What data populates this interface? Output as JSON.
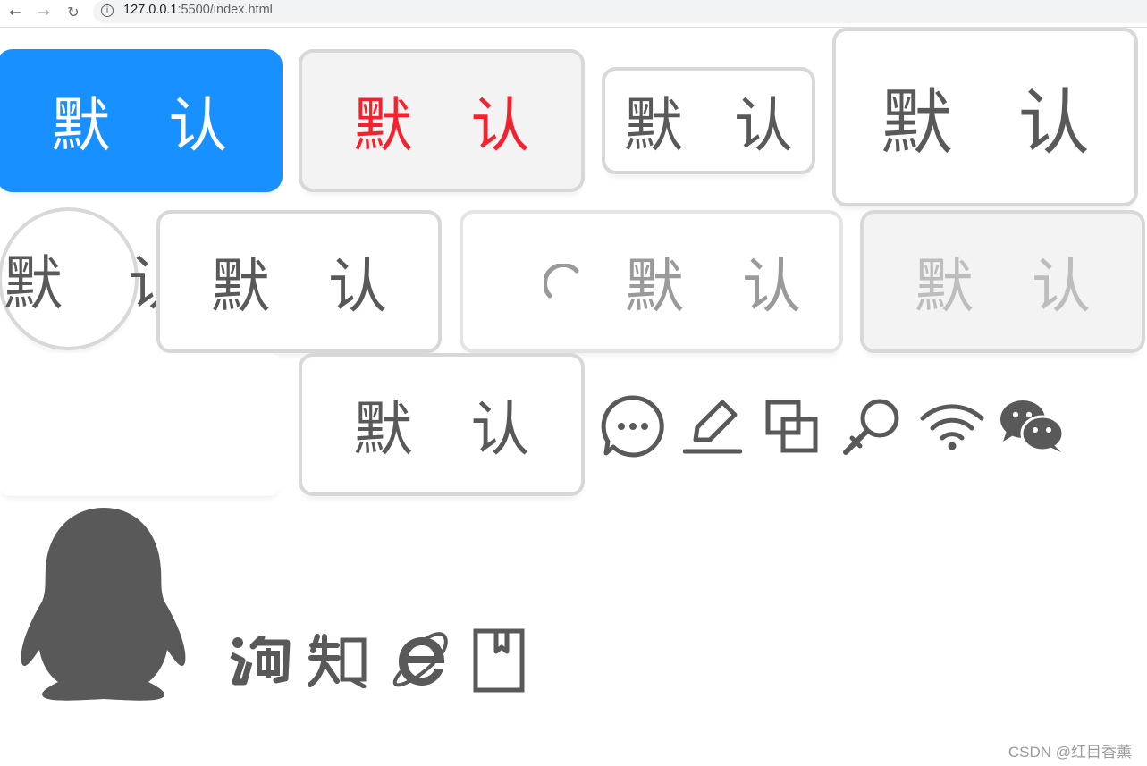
{
  "browser": {
    "back": "←",
    "forward": "→",
    "reload": "↻",
    "info": "i",
    "url_host": "127.0.0.1",
    "url_rest": ":5500/index.html"
  },
  "buttons": {
    "primary": "默 认",
    "danger": "默 认",
    "small": "默 认",
    "large": "默 认",
    "circle": "默 认",
    "default": "默 认",
    "loading": "默 认",
    "disabled": "默 认",
    "row3": "默 认"
  },
  "icons": [
    "message-icon",
    "edit-icon",
    "copy-icon",
    "search-key-icon",
    "wifi-icon",
    "wechat-icon",
    "qq-icon",
    "taobao-icon",
    "zhihu-icon",
    "ie-icon",
    "bookmark-icon"
  ],
  "colors": {
    "primary": "#1890ff",
    "danger": "#f5222d",
    "icon": "#595959",
    "border": "#d8d8d8"
  },
  "watermark": "CSDN @红目香薰"
}
